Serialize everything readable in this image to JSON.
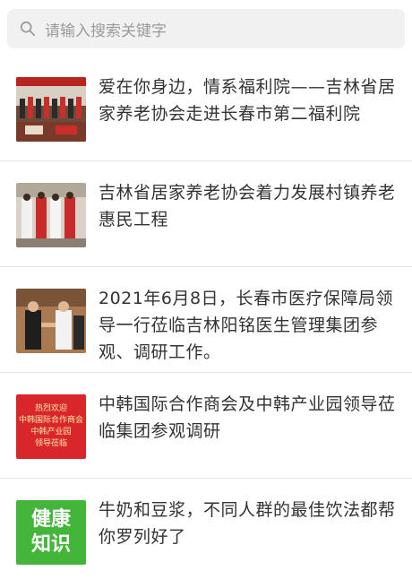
{
  "search": {
    "placeholder": "请输入搜索关键字"
  },
  "articles": [
    {
      "title": "爱在你身边，情系福利院——吉林省居家养老协会走进长春市第二福利院",
      "thumb_icon": "group-photo-banner"
    },
    {
      "title": "吉林省居家养老协会着力发展村镇养老惠民工程",
      "thumb_icon": "people-holding-gifts"
    },
    {
      "title": "2021年6月8日，长春市医疗保障局领导一行莅临吉林阳铭医生管理集团参观、调研工作。",
      "thumb_icon": "handshake-photo"
    },
    {
      "title": "中韩国际合作商会及中韩产业园领导莅临集团参观调研",
      "thumb_icon": "red-welcome-banner",
      "thumb_text": [
        "热烈欢迎",
        "中韩国际合作商会",
        "中韩产业园",
        "领导莅临"
      ]
    },
    {
      "title": "牛奶和豆浆，不同人群的最佳饮法都帮你罗列好了",
      "thumb_icon": "health-knowledge-tile",
      "thumb_text": [
        "健康",
        "知识"
      ]
    }
  ],
  "colors": {
    "accent_red": "#d9262b",
    "green_tile": "#43b53a"
  }
}
